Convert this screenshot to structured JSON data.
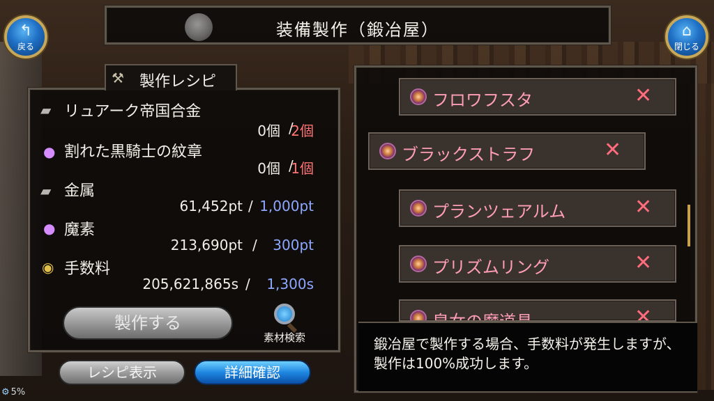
{
  "header": {
    "title": "装備製作（鍛冶屋）",
    "back_label": "戻る",
    "close_label": "閉じる"
  },
  "recipe": {
    "header_label": "製作レシピ",
    "materials": [
      {
        "icon": "ingot-icon",
        "name": "リュアーク帝国合金",
        "have": "0個",
        "required": "2個",
        "req_color": "#ff7474"
      },
      {
        "icon": "orb-icon",
        "name": "割れた黒騎士の紋章",
        "have": "0個",
        "required": "1個",
        "req_color": "#ff7474"
      },
      {
        "icon": "ingot-icon",
        "name": "金属",
        "have": "61,452pt",
        "required": "1,000pt",
        "req_color": "#8ea8ff"
      },
      {
        "icon": "orb-icon",
        "name": "魔素",
        "have": "213,690pt",
        "required": "300pt",
        "req_color": "#8ea8ff"
      },
      {
        "icon": "coins-icon",
        "name": "手数料",
        "have": "205,621,865s",
        "required": "1,300s",
        "req_color": "#8ea8ff"
      }
    ],
    "separator": "/",
    "craft_button": "製作する",
    "search_label": "素材検索",
    "recipe_view_button": "レシピ表示",
    "detail_button": "詳細確認"
  },
  "equipment_list": [
    {
      "name": "フロワフスタ"
    },
    {
      "name": "ブラックストラフ"
    },
    {
      "name": "プランツェアルム"
    },
    {
      "name": "プリズムリング"
    },
    {
      "name": "皇女の魔道具"
    }
  ],
  "description": "鍛冶屋で製作する場合、手数料が発生しますが、製作は100%成功します。",
  "status": {
    "percent": "5%"
  }
}
